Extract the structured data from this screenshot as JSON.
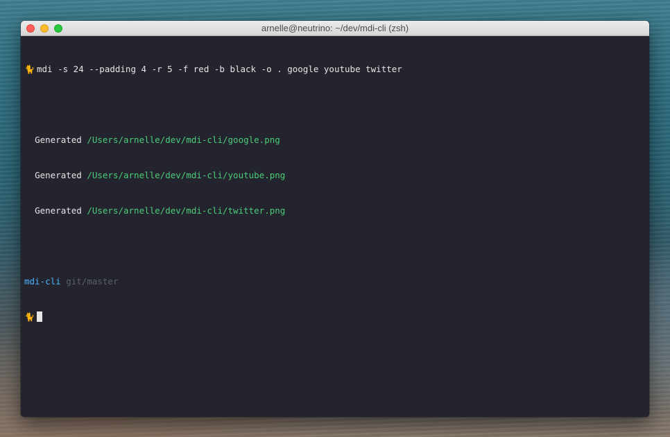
{
  "window": {
    "title": "arnelle@neutrino: ~/dev/mdi-cli (zsh)"
  },
  "terminal": {
    "prompt_glyph": "🐈",
    "command": "mdi -s 24 --padding 4 -r 5 -f red -b black -o . google youtube twitter",
    "outputs": [
      {
        "label": "Generated",
        "path": "/Users/arnelle/dev/mdi-cli/google.png"
      },
      {
        "label": "Generated",
        "path": "/Users/arnelle/dev/mdi-cli/youtube.png"
      },
      {
        "label": "Generated",
        "path": "/Users/arnelle/dev/mdi-cli/twitter.png"
      }
    ],
    "cwd": "mdi-cli",
    "git_branch": "git/master"
  },
  "colors": {
    "terminal_bg": "#23242d",
    "path_green": "#4ccc7a",
    "dir_blue": "#4ab3ff",
    "branch_gray": "#5b5e6a"
  }
}
